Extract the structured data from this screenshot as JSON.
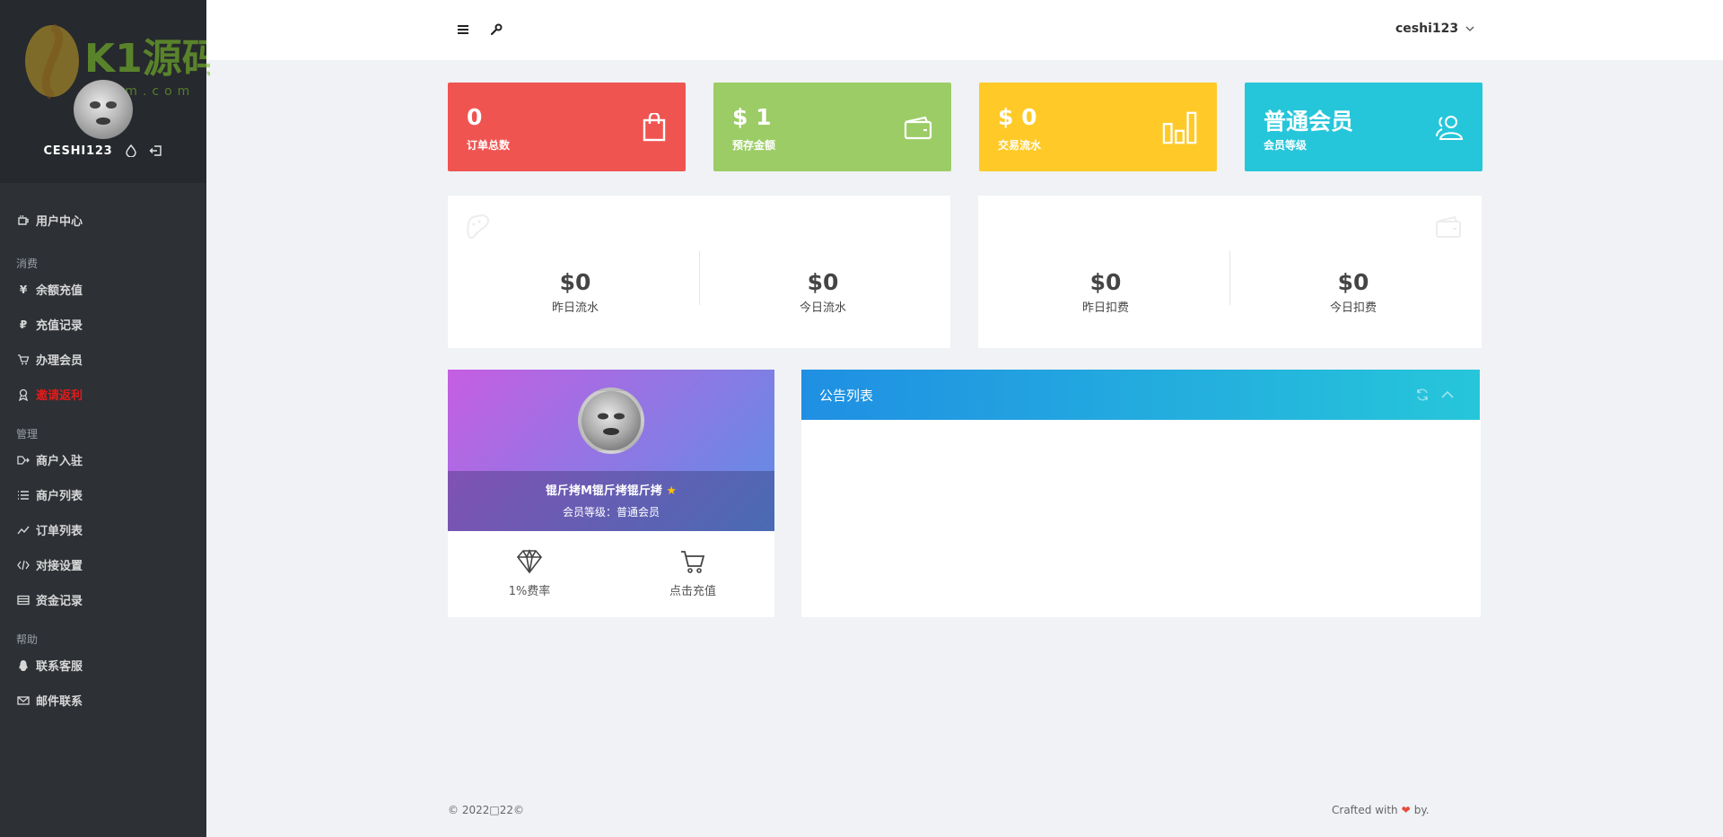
{
  "sidebar": {
    "watermark": {
      "brand": "K1源码",
      "domain": "k1ym.com"
    },
    "username": "CESHI123",
    "nav": [
      {
        "type": "item",
        "label": "用户中心",
        "icon": "coffee-cup-icon"
      },
      {
        "type": "header",
        "label": "消费"
      },
      {
        "type": "item",
        "label": "余额充值",
        "icon": "yen-icon"
      },
      {
        "type": "item",
        "label": "充值记录",
        "icon": "ruble-icon"
      },
      {
        "type": "item",
        "label": "办理会员",
        "icon": "cart-icon"
      },
      {
        "type": "item",
        "label": "邀请返利",
        "icon": "award-icon",
        "highlight": true
      },
      {
        "type": "header",
        "label": "管理"
      },
      {
        "type": "item",
        "label": "商户入驻",
        "icon": "sign-in-icon"
      },
      {
        "type": "item",
        "label": "商户列表",
        "icon": "list-icon"
      },
      {
        "type": "item",
        "label": "订单列表",
        "icon": "trend-icon"
      },
      {
        "type": "item",
        "label": "对接设置",
        "icon": "code-icon"
      },
      {
        "type": "item",
        "label": "资金记录",
        "icon": "table-icon"
      },
      {
        "type": "header",
        "label": "帮助"
      },
      {
        "type": "item",
        "label": "联系客服",
        "icon": "qq-icon"
      },
      {
        "type": "item",
        "label": "邮件联系",
        "icon": "mail-icon"
      }
    ]
  },
  "topbar": {
    "username": "ceshi123"
  },
  "stats": [
    {
      "value": "0",
      "label": "订单总数",
      "color": "#f05451",
      "icon": "shopping-bag-icon"
    },
    {
      "value": "$ 1",
      "label": "预存金额",
      "color": "#9ccc65",
      "icon": "wallet-icon"
    },
    {
      "value": "$ 0",
      "label": "交易流水",
      "color": "#ffca28",
      "icon": "bar-chart-icon"
    },
    {
      "value": "普通会员",
      "label": "会员等级",
      "color": "#26c6da",
      "icon": "users-icon"
    }
  ],
  "flow": {
    "yesterday": {
      "value": "$0",
      "label": "昨日流水"
    },
    "today": {
      "value": "$0",
      "label": "今日流水"
    }
  },
  "deduct": {
    "yesterday": {
      "value": "$0",
      "label": "昨日扣费"
    },
    "today": {
      "value": "$0",
      "label": "今日扣费"
    }
  },
  "profile": {
    "name": "锟斤拷M锟斤拷锟斤拷",
    "level_text": "会员等级：普通会员",
    "rate_label": "1%费率",
    "recharge_label": "点击充值"
  },
  "notice": {
    "title": "公告列表"
  },
  "footer": {
    "left": "© 2022□22©",
    "right_prefix": "Crafted with",
    "right_suffix": "by."
  }
}
